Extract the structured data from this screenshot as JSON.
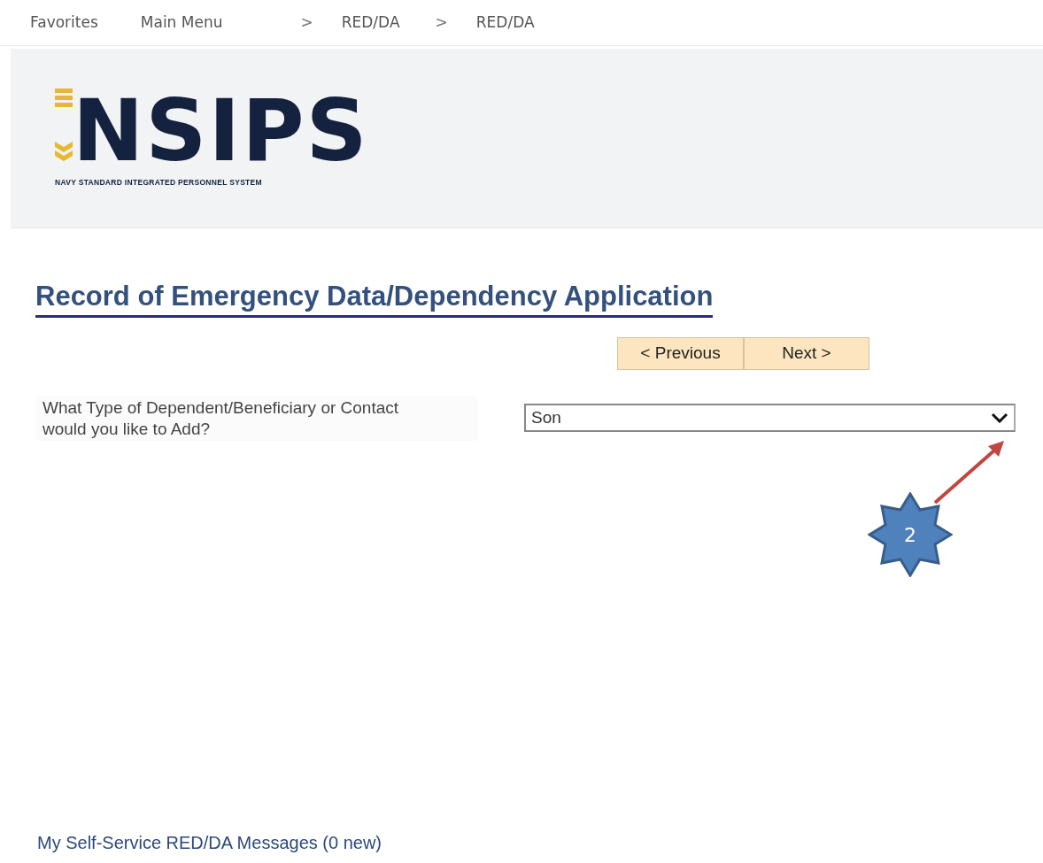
{
  "nav": {
    "items": [
      {
        "label": "Favorites",
        "separator": false
      },
      {
        "label": "Main Menu",
        "separator": false
      },
      {
        "label": "RED/DA",
        "separator": true
      },
      {
        "label": "RED/DA",
        "separator": true
      }
    ],
    "separator_glyph": ">"
  },
  "logo": {
    "wordmark": "NSIPS",
    "tagline": "NAVY STANDARD INTEGRATED PERSONNEL SYSTEM"
  },
  "page_title": "Record of Emergency Data/Dependency Application",
  "buttons": [
    "< Previous",
    "Next >"
  ],
  "question": {
    "label": "What Type of Dependent/Beneficiary or Contact would you like to Add?",
    "value": "Son"
  },
  "callout": {
    "number": "2"
  },
  "footer_link": "My Self-Service RED/DA Messages (0 new)"
}
